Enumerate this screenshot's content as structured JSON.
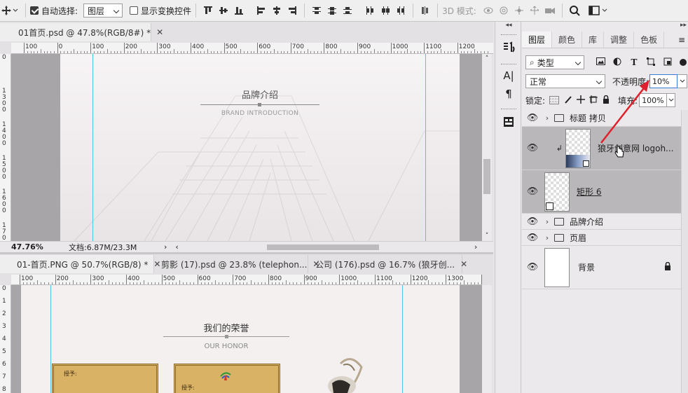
{
  "options_bar": {
    "auto_select_label": "自动选择:",
    "auto_select_value": "图层",
    "show_transform_label": "显示变换控件",
    "mode_3d_label": "3D 模式:"
  },
  "doc_top": {
    "tab_title": "01首页.psd @ 47.8%(RGB/8#) *",
    "ruler_h": [
      "100",
      "0",
      "100",
      "200",
      "300",
      "400",
      "500",
      "600",
      "700",
      "800",
      "900",
      "1000",
      "1100",
      "1200"
    ],
    "ruler_v": [
      "0",
      "1\n3\n0\n0",
      "1\n4\n0\n0",
      "1\n5\n0\n0",
      "1\n6\n0\n0",
      "1\n7\n0\n0"
    ],
    "heading_cn": "品牌介绍",
    "heading_en": "BRAND INTRODUCTION",
    "zoom": "47.76%",
    "doc_info": "文档:6.87M/23.3M"
  },
  "doc_bottom": {
    "tabs": [
      {
        "title": "01-首页.PNG @ 50.7%(RGB/8) *"
      },
      {
        "title": "剪影 (17).psd @ 23.8% (telephon..."
      },
      {
        "title": "公司 (176).psd @ 16.7% (狼牙创..."
      }
    ],
    "ruler_h": [
      "100",
      "200",
      "300",
      "400",
      "500",
      "600",
      "700",
      "800",
      "900",
      "1000",
      "1100",
      "1200",
      "1300",
      "14"
    ],
    "ruler_v": [
      "0",
      "1",
      "2",
      "3",
      "4",
      "5",
      "6",
      "7",
      "8"
    ],
    "heading_cn": "我们的荣誉",
    "heading_en": "OUR HONOR",
    "cert_left_text": "授予:",
    "cert_right_text": "授予:"
  },
  "layers_panel": {
    "tabs": [
      "图层",
      "颜色",
      "库",
      "调整",
      "色板"
    ],
    "filter_kind": "类型",
    "blend_mode": "正常",
    "opacity_label": "不透明度:",
    "opacity_value": "10%",
    "lock_label": "锁定:",
    "fill_label": "填充:",
    "fill_value": "100%",
    "layers": [
      {
        "name": "标题 拷贝",
        "type": "group"
      },
      {
        "name": "狼牙创意网 logoh...",
        "type": "smart"
      },
      {
        "name": "矩形 6",
        "type": "shape"
      },
      {
        "name": "品牌介绍",
        "type": "group"
      },
      {
        "name": "页眉",
        "type": "group"
      },
      {
        "name": "背景",
        "type": "background"
      }
    ]
  },
  "colors": {
    "guide": "#4fc6e6",
    "annotation_arrow": "#e0202a",
    "selected_layer": "#b9b7b9"
  }
}
